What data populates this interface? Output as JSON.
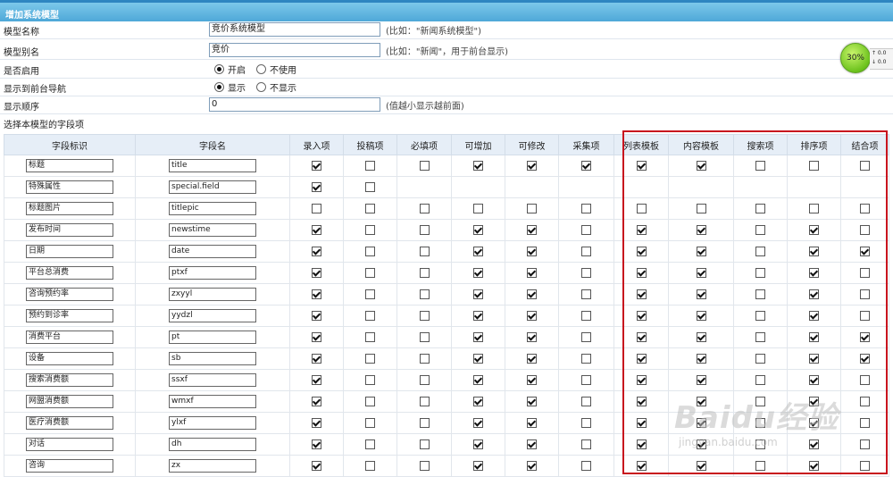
{
  "panel": {
    "title": "增加系统模型"
  },
  "form": {
    "model_name": {
      "label": "模型名称",
      "value": "竞价系统模型",
      "hint": "(比如：\"新闻系统模型\")"
    },
    "model_alias": {
      "label": "模型别名",
      "value": "竞价",
      "hint": "(比如：\"新闻\"，用于前台显示)"
    },
    "enabled": {
      "label": "是否启用",
      "options": [
        "开启",
        "不使用"
      ],
      "selected": 0
    },
    "show_nav": {
      "label": "显示到前台导航",
      "options": [
        "显示",
        "不显示"
      ],
      "selected": 0
    },
    "order": {
      "label": "显示顺序",
      "value": "0",
      "hint": "(值越小显示越前面)"
    },
    "section_label": "选择本模型的字段项"
  },
  "table": {
    "headers": [
      "字段标识",
      "字段名",
      "录入项",
      "投稿项",
      "必填项",
      "可增加",
      "可修改",
      "采集项",
      "列表模板",
      "内容模板",
      "搜索项",
      "排序项",
      "结合项"
    ],
    "rows": [
      {
        "label": "标题",
        "name": "title",
        "checks": [
          1,
          0,
          0,
          1,
          1,
          1,
          1,
          1,
          0,
          0,
          0
        ]
      },
      {
        "label": "特殊属性",
        "name": "special.field",
        "checks": [
          1,
          0,
          null,
          null,
          null,
          null,
          null,
          null,
          null,
          null,
          null
        ]
      },
      {
        "label": "标题图片",
        "name": "titlepic",
        "checks": [
          0,
          0,
          0,
          0,
          0,
          0,
          0,
          0,
          0,
          0,
          0
        ]
      },
      {
        "label": "发布时间",
        "name": "newstime",
        "checks": [
          1,
          0,
          0,
          1,
          1,
          0,
          1,
          1,
          0,
          1,
          0
        ]
      },
      {
        "label": "日期",
        "name": "date",
        "checks": [
          1,
          0,
          0,
          1,
          1,
          0,
          1,
          1,
          0,
          1,
          1
        ]
      },
      {
        "label": "平台总消费",
        "name": "ptxf",
        "checks": [
          1,
          0,
          0,
          1,
          1,
          0,
          1,
          1,
          0,
          1,
          0
        ]
      },
      {
        "label": "咨询预约率",
        "name": "zxyyl",
        "checks": [
          1,
          0,
          0,
          1,
          1,
          0,
          1,
          1,
          0,
          1,
          0
        ]
      },
      {
        "label": "预约到诊率",
        "name": "yydzl",
        "checks": [
          1,
          0,
          0,
          1,
          1,
          0,
          1,
          1,
          0,
          1,
          0
        ]
      },
      {
        "label": "消费平台",
        "name": "pt",
        "checks": [
          1,
          0,
          0,
          1,
          1,
          0,
          1,
          1,
          0,
          1,
          1
        ]
      },
      {
        "label": "设备",
        "name": "sb",
        "checks": [
          1,
          0,
          0,
          1,
          1,
          0,
          1,
          1,
          0,
          1,
          1
        ]
      },
      {
        "label": "搜索消费额",
        "name": "ssxf",
        "checks": [
          1,
          0,
          0,
          1,
          1,
          0,
          1,
          1,
          0,
          1,
          0
        ]
      },
      {
        "label": "网盟消费额",
        "name": "wmxf",
        "checks": [
          1,
          0,
          0,
          1,
          1,
          0,
          1,
          1,
          0,
          1,
          0
        ]
      },
      {
        "label": "医疗消费额",
        "name": "ylxf",
        "checks": [
          1,
          0,
          0,
          1,
          1,
          0,
          1,
          1,
          0,
          1,
          0
        ]
      },
      {
        "label": "对话",
        "name": "dh",
        "checks": [
          1,
          0,
          0,
          1,
          1,
          0,
          1,
          1,
          0,
          1,
          0
        ]
      },
      {
        "label": "咨询",
        "name": "zx",
        "checks": [
          1,
          0,
          0,
          1,
          1,
          0,
          1,
          1,
          0,
          1,
          0
        ]
      }
    ]
  },
  "widget": {
    "percent": "30%",
    "line1": "↑ 0.0",
    "line2": "↓ 0.0"
  },
  "watermark": {
    "logo": "Baidu经验",
    "url": "jingyan.baidu.com"
  },
  "colors": {
    "header_bg": "#4ea8d8",
    "highlight": "#c8141e",
    "table_header": "#e6eef7"
  }
}
